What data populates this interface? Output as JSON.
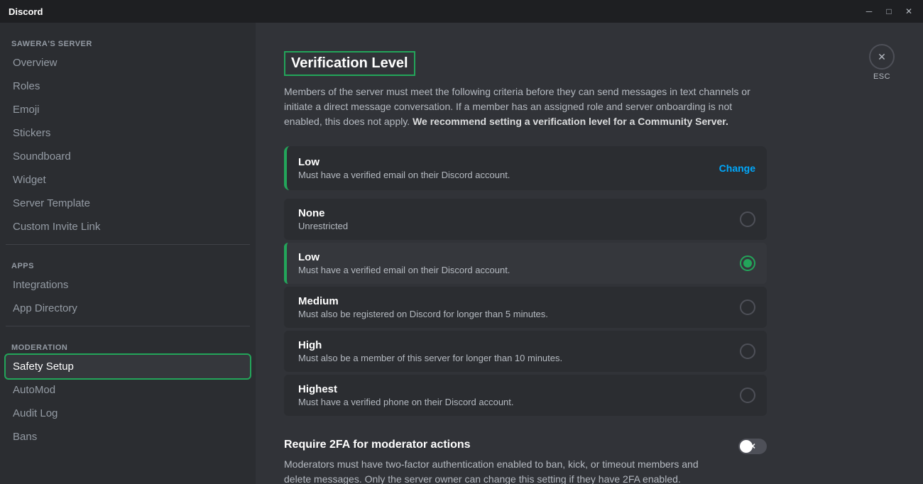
{
  "titlebar": {
    "title": "Discord",
    "minimize": "─",
    "maximize": "□",
    "close": "✕"
  },
  "sidebar": {
    "server_name": "SAWERA'S SERVER",
    "items_main": [
      {
        "label": "Overview",
        "id": "overview"
      },
      {
        "label": "Roles",
        "id": "roles"
      },
      {
        "label": "Emoji",
        "id": "emoji"
      },
      {
        "label": "Stickers",
        "id": "stickers"
      },
      {
        "label": "Soundboard",
        "id": "soundboard"
      },
      {
        "label": "Widget",
        "id": "widget"
      },
      {
        "label": "Server Template",
        "id": "server-template"
      },
      {
        "label": "Custom Invite Link",
        "id": "custom-invite"
      }
    ],
    "section_apps": "APPS",
    "items_apps": [
      {
        "label": "Integrations",
        "id": "integrations"
      },
      {
        "label": "App Directory",
        "id": "app-directory"
      }
    ],
    "section_moderation": "MODERATION",
    "items_moderation": [
      {
        "label": "Safety Setup",
        "id": "safety-setup"
      },
      {
        "label": "AutoMod",
        "id": "automod"
      },
      {
        "label": "Audit Log",
        "id": "audit-log"
      },
      {
        "label": "Bans",
        "id": "bans"
      }
    ]
  },
  "main": {
    "title": "Verification Level",
    "description_start": "Members of the server must meet the following criteria before they can send messages in text channels or initiate a direct message conversation. If a member has an assigned role and server onboarding is not enabled, this does not apply. ",
    "description_bold": "We recommend setting a verification level for a Community Server.",
    "current_level": {
      "name": "Low",
      "description": "Must have a verified email on their Discord account.",
      "change_label": "Change"
    },
    "levels": [
      {
        "name": "None",
        "description": "Unrestricted",
        "selected": false,
        "id": "none"
      },
      {
        "name": "Low",
        "description": "Must have a verified email on their Discord account.",
        "selected": true,
        "id": "low"
      },
      {
        "name": "Medium",
        "description": "Must also be registered on Discord for longer than 5 minutes.",
        "selected": false,
        "id": "medium"
      },
      {
        "name": "High",
        "description": "Must also be a member of this server for longer than 10 minutes.",
        "selected": false,
        "id": "high"
      },
      {
        "name": "Highest",
        "description": "Must have a verified phone on their Discord account.",
        "selected": false,
        "id": "highest"
      }
    ],
    "tfa": {
      "title": "Require 2FA for moderator actions",
      "description": "Moderators must have two-factor authentication enabled to ban, kick, or timeout members and delete messages. Only the server owner can change this setting if they have 2FA enabled.",
      "toggle_on": false
    },
    "esc_label": "ESC"
  }
}
